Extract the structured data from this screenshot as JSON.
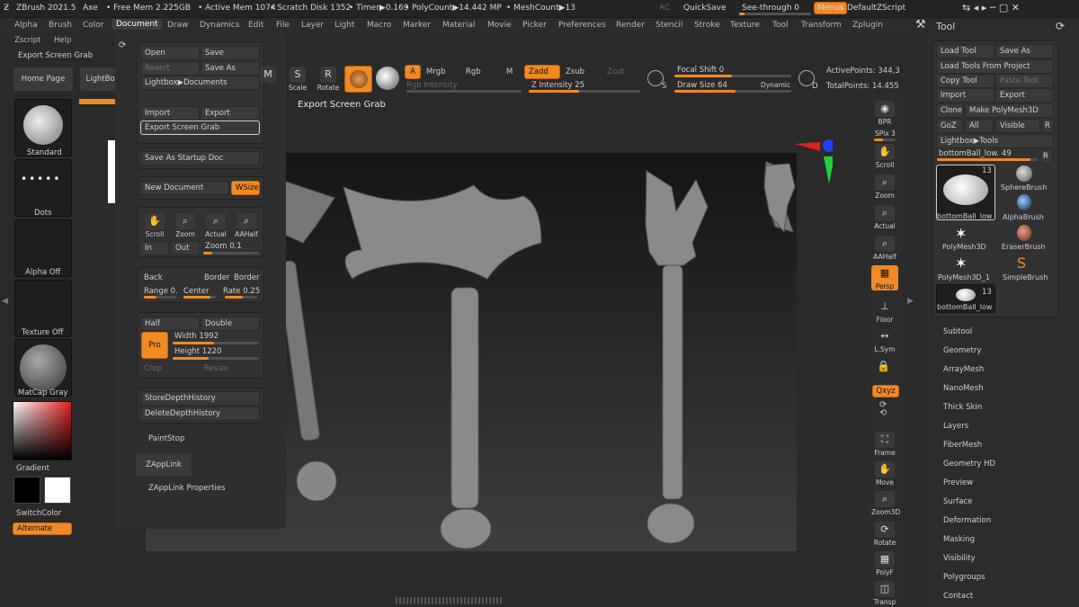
{
  "titlebar": {
    "app": "ZBrush 2021.5",
    "tool": "Axe",
    "free_mem": "• Free Mem 2.225GB",
    "active_mem": "• Active Mem 1074",
    "scratch": "• Scratch Disk 1352",
    "timer": "• Timer▶0.169",
    "polycount": "• PolyCount▶14.442 MP",
    "meshcount": "• MeshCount▶13",
    "ac": "AC",
    "quicksave": "QuickSave",
    "seethrough": "See-through",
    "seethrough_val": "0",
    "menus": "Menus",
    "defaultzscript": "DefaultZScript"
  },
  "menubar": [
    "Alpha",
    "Brush",
    "Color",
    "Document",
    "Draw",
    "Dynamics",
    "Edit",
    "File",
    "Layer",
    "Light",
    "Macro",
    "Marker",
    "Material",
    "Movie",
    "Picker",
    "Preferences",
    "Render",
    "Stencil",
    "Stroke",
    "Texture",
    "Tool",
    "Transform",
    "Zplugin"
  ],
  "menubar2": [
    "Zscript",
    "Help"
  ],
  "export_tooltip_left": "Export Screen Grab",
  "left": {
    "home_page": "Home Page",
    "lightbox": "LightBox",
    "standard": "Standard",
    "dots": "Dots",
    "alpha_off": "Alpha Off",
    "texture_off": "Texture Off",
    "matcap": "MatCap Gray",
    "gradient": "Gradient",
    "switchcolor": "SwitchColor",
    "alternate": "Alternate"
  },
  "doc": {
    "open": "Open",
    "save": "Save",
    "revert": "Revert",
    "save_as": "Save As",
    "lightbox_docs": "Lightbox▶Documents",
    "import": "Import",
    "export": "Export",
    "export_screen_grab": "Export Screen Grab",
    "save_startup": "Save As Startup Doc",
    "new_document": "New Document",
    "wsize": "WSize",
    "scroll": "Scroll",
    "zoom": "Zoom",
    "actual": "Actual",
    "aahalf": "AAHalf",
    "in": "In",
    "out": "Out",
    "zoom_lbl": "Zoom 0.1",
    "back": "Back",
    "border1": "Border",
    "border2": "Border",
    "range": "Range 0.",
    "center": "Center",
    "rate": "Rate 0.25",
    "half": "Half",
    "double": "Double",
    "pro": "Pro",
    "width": "Width",
    "width_val": "1992",
    "height": "Height",
    "height_val": "1220",
    "crop": "Crop",
    "resize": "Resize",
    "store_depth": "StoreDepthHistory",
    "delete_depth": "DeleteDepthHistory",
    "paintstop": "PaintStop",
    "zapplink": "ZAppLink",
    "zapplink_props": "ZAppLink Properties"
  },
  "toolbar": {
    "scale": "Scale",
    "rotate": "Rotate",
    "a": "A",
    "mrgb": "Mrgb",
    "rgb": "Rgb",
    "m": "M",
    "zadd": "Zadd",
    "zsub": "Zsub",
    "zcut": "Zcut",
    "rgb_intensity": "Rgb Intensity",
    "z_intensity": "Z Intensity",
    "z_intensity_val": "25",
    "focal_shift": "Focal Shift",
    "focal_shift_val": "0",
    "draw_size": "Draw Size",
    "draw_size_val": "64",
    "dynamic": "Dynamic",
    "s": "S",
    "d": "D",
    "active_points": "ActivePoints: 344,3",
    "total_points": "TotalPoints: 14.455",
    "tooltip": "Export Screen Grab"
  },
  "right_shelf": [
    "BPR",
    "SPix 3",
    "Scroll",
    "Zoom",
    "Actual",
    "AAHalf",
    "Persp",
    "Floor",
    "L.Sym",
    "Qxyz",
    "Frame",
    "Move",
    "Zoom3D",
    "Rotate",
    "PolyF",
    "Transp"
  ],
  "tool": {
    "title": "Tool",
    "load_tool": "Load Tool",
    "save_as": "Save As",
    "load_from_project": "Load Tools From Project",
    "copy_tool": "Copy Tool",
    "paste_tool": "Paste Tool",
    "import": "Import",
    "export": "Export",
    "clone": "Clone",
    "make_polymesh": "Make PolyMesh3D",
    "goz": "GoZ",
    "all": "All",
    "visible": "Visible",
    "r": "R",
    "lightbox_tools": "Lightbox▶Tools",
    "current": "bottomBall_low.",
    "current_val": "49",
    "thumb_count": "13",
    "items": [
      "bottomBall_low",
      "SphereBrush",
      "AlphaBrush",
      "PolyMesh3D",
      "EraserBrush",
      "PolyMesh3D_1",
      "SimpleBrush",
      "bottomBall_low"
    ],
    "count2": "13"
  },
  "subpalettes": [
    "Subtool",
    "Geometry",
    "ArrayMesh",
    "NanoMesh",
    "Thick Skin",
    "Layers",
    "FiberMesh",
    "Geometry HD",
    "Preview",
    "Surface",
    "Deformation",
    "Masking",
    "Visibility",
    "Polygroups",
    "Contact"
  ],
  "colors": {
    "accent": "#f08a24",
    "bg": "#2a2a2a",
    "panel": "#323232"
  }
}
